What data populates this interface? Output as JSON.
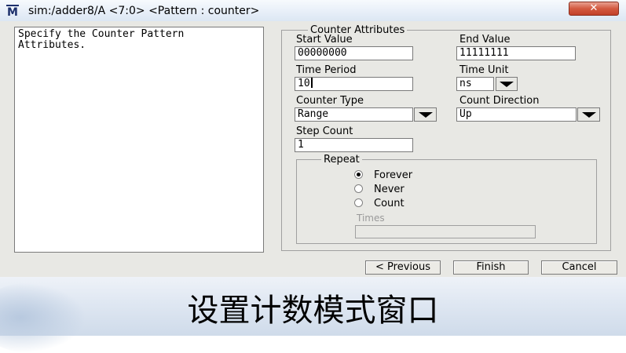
{
  "window": {
    "title": "sim:/adder8/A <7:0> <Pattern : counter>",
    "logo": "M",
    "close_label": "✕"
  },
  "description": "Specify the Counter Pattern\nAttributes.",
  "counter_attributes": {
    "legend": "Counter Attributes",
    "start_value": {
      "label": "Start Value",
      "value": "00000000"
    },
    "end_value": {
      "label": "End Value",
      "value": "11111111"
    },
    "time_period": {
      "label": "Time Period",
      "value": "10"
    },
    "time_unit": {
      "label": "Time Unit",
      "value": "ns"
    },
    "counter_type": {
      "label": "Counter Type",
      "value": "Range"
    },
    "count_direction": {
      "label": "Count Direction",
      "value": "Up"
    },
    "step_count": {
      "label": "Step Count",
      "value": "1"
    }
  },
  "repeat": {
    "legend": "Repeat",
    "options": [
      {
        "label": "Forever",
        "checked": true
      },
      {
        "label": "Never",
        "checked": false
      },
      {
        "label": "Count",
        "checked": false
      }
    ],
    "times_label": "Times",
    "times_value": ""
  },
  "buttons": {
    "previous": "< Previous",
    "finish": "Finish",
    "cancel": "Cancel"
  },
  "caption": "设置计数模式窗口",
  "colors": {
    "close_button": "#d35a40",
    "logo": "#1c2f6b",
    "dialog_bg": "#e8e8e4"
  }
}
